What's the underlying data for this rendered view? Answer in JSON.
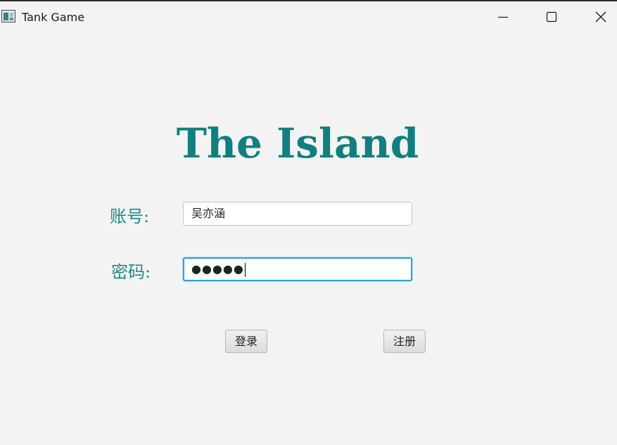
{
  "window": {
    "title": "Tank Game",
    "controls": [
      "minimize-icon",
      "maximize-icon",
      "close-icon"
    ]
  },
  "main": {
    "heading": "The Island",
    "account_label": "账号:",
    "account_value": "吴亦涵",
    "password_label": "密码:",
    "password_value": "●●●●●",
    "login_button": "登录",
    "register_button": "注册"
  },
  "colors": {
    "accent_teal": "#0f7f7f",
    "label_teal": "#1a8a8c",
    "focus_border": "#2aa3d6",
    "background": "#f3f3f3"
  }
}
